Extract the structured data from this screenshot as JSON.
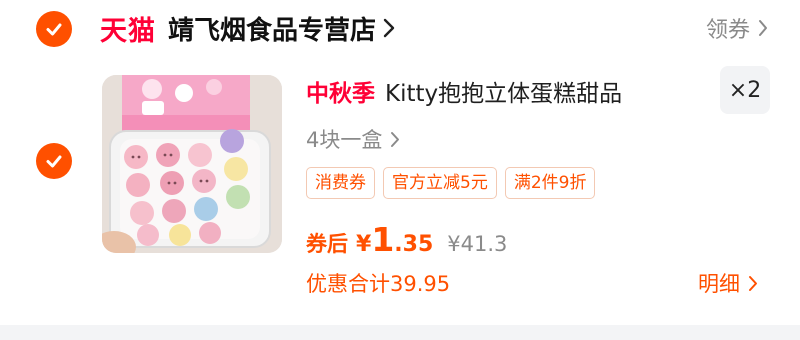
{
  "store": {
    "brand": "天猫",
    "name": "靖飞烟食品专营店",
    "coupon_link": "领券"
  },
  "item": {
    "promo_word": "中秋季",
    "title": "Kitty抱抱立体蛋糕甜品",
    "quantity": "×2",
    "sku": "4块一盒",
    "tags": [
      "消费券",
      "官方立减5元",
      "满2件9折"
    ],
    "after_coupon_label": "券后",
    "currency": "¥",
    "price_int": "1",
    "price_dec": ".35",
    "original_price": "¥41.3",
    "discount_total": "优惠合计39.95",
    "detail_link": "明细",
    "selected": true
  },
  "store_selected": true,
  "colors": {
    "accent": "#ff5000",
    "tmall_red": "#ff0036",
    "tag_border": "#f3c9b3",
    "muted": "#8a8a8a"
  },
  "icons": {
    "check": "check-icon",
    "chevron": "chevron-right-icon"
  }
}
